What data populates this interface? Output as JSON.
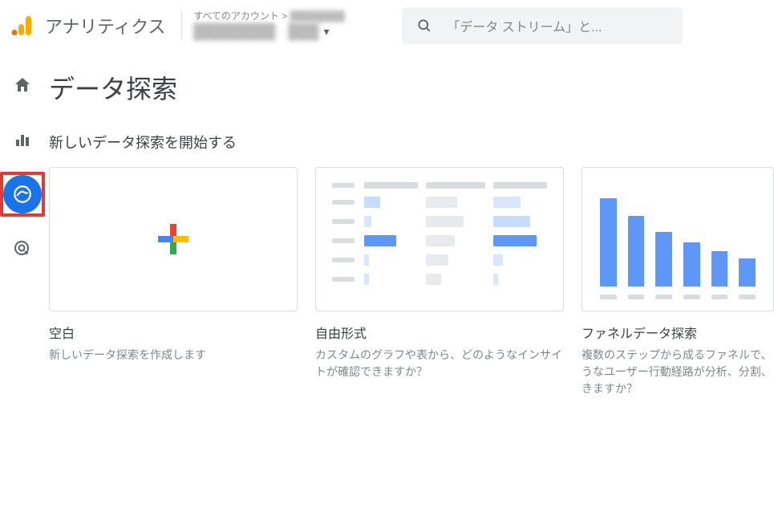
{
  "header": {
    "app_title": "アナリティクス",
    "account_breadcrumb_prefix": "すべてのアカウント >",
    "search_placeholder": "「データ ストリーム」と..."
  },
  "page": {
    "title": "データ探索",
    "subtitle": "新しいデータ探索を開始する"
  },
  "cards": [
    {
      "title": "空白",
      "desc": "新しいデータ探索を作成します"
    },
    {
      "title": "自由形式",
      "desc": "カスタムのグラフや表から、どのようなインサイトが確認できますか？"
    },
    {
      "title": "ファネルデータ探索",
      "desc": "複数のステップから成るファネルで、うなユーザー行動経路が分析、分割、きますか？"
    }
  ]
}
